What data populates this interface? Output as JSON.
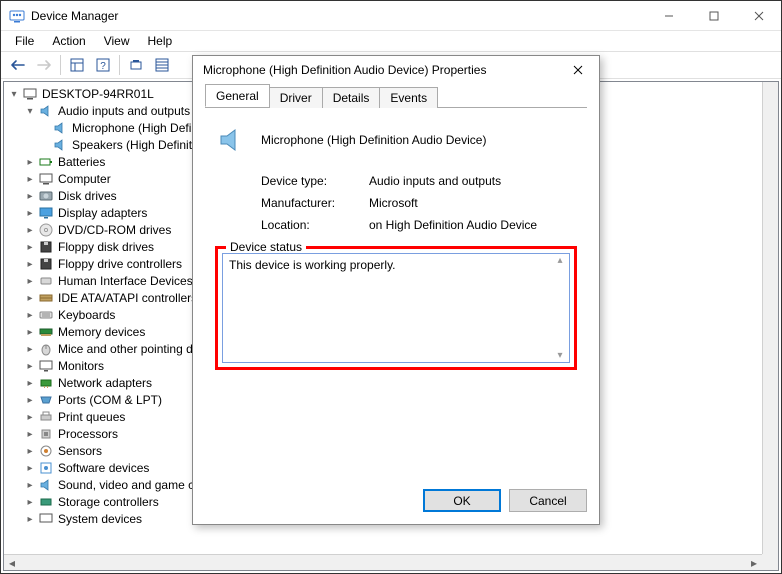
{
  "window": {
    "title": "Device Manager",
    "menu": {
      "file": "File",
      "action": "Action",
      "view": "View",
      "help": "Help"
    }
  },
  "tree": {
    "root": "DESKTOP-94RR01L",
    "audio": {
      "label": "Audio inputs and outputs",
      "mic": "Microphone (High Definition Audio Device)",
      "spk": "Speakers (High Definition Audio Device)"
    },
    "nodes": {
      "batteries": "Batteries",
      "computer": "Computer",
      "diskdrives": "Disk drives",
      "display": "Display adapters",
      "dvd": "DVD/CD-ROM drives",
      "floppydisk": "Floppy disk drives",
      "floppyctrl": "Floppy drive controllers",
      "hid": "Human Interface Devices",
      "ide": "IDE ATA/ATAPI controllers",
      "keyboards": "Keyboards",
      "memory": "Memory devices",
      "mice": "Mice and other pointing devices",
      "monitors": "Monitors",
      "network": "Network adapters",
      "ports": "Ports (COM & LPT)",
      "printq": "Print queues",
      "processors": "Processors",
      "sensors": "Sensors",
      "softdev": "Software devices",
      "soundvg": "Sound, video and game controllers",
      "storage": "Storage controllers",
      "sysdev": "System devices"
    }
  },
  "dialog": {
    "title": "Microphone (High Definition Audio Device) Properties",
    "tabs": {
      "general": "General",
      "driver": "Driver",
      "details": "Details",
      "events": "Events"
    },
    "device_name": "Microphone (High Definition Audio Device)",
    "labels": {
      "type": "Device type:",
      "mfr": "Manufacturer:",
      "loc": "Location:"
    },
    "values": {
      "type": "Audio inputs and outputs",
      "mfr": "Microsoft",
      "loc": "on High Definition Audio Device"
    },
    "status_legend": "Device status",
    "status_text": "This device is working properly.",
    "buttons": {
      "ok": "OK",
      "cancel": "Cancel"
    }
  }
}
